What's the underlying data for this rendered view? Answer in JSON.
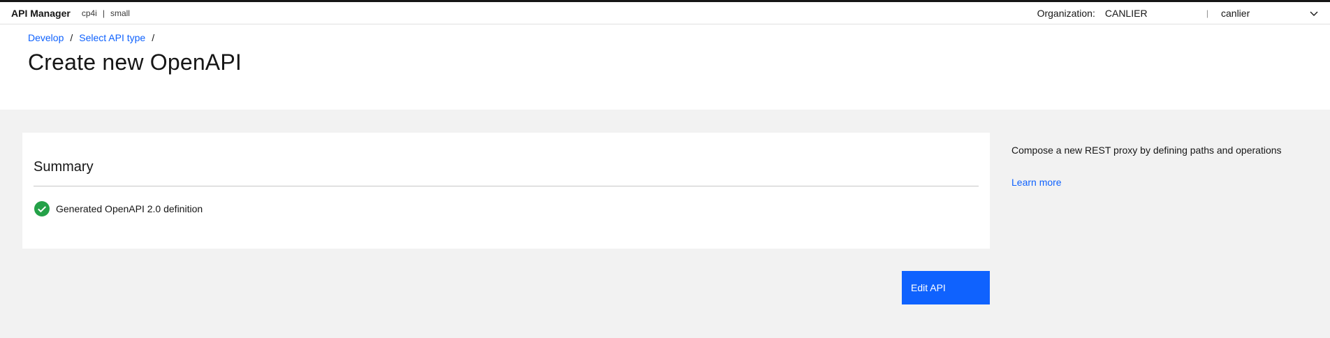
{
  "header": {
    "brand": "API Manager",
    "instance_name": "cp4i",
    "instance_sep": "|",
    "instance_size": "small",
    "org_label": "Organization:",
    "org_name": "CANLIER",
    "separator": "|",
    "user_name": "canlier",
    "user_menu_icon": "chevron-down-icon"
  },
  "breadcrumb": {
    "items": [
      "Develop",
      "Select API type"
    ],
    "separator": "/"
  },
  "page": {
    "title": "Create new OpenAPI"
  },
  "summary": {
    "title": "Summary",
    "status_icon": "checkmark-filled-icon",
    "status_text": "Generated OpenAPI 2.0 definition"
  },
  "sidepanel": {
    "description": "Compose a new REST proxy by defining paths and operations",
    "link": "Learn more"
  },
  "actions": {
    "edit_label": "Edit API"
  },
  "colors": {
    "link": "#0f62fe",
    "primary": "#0f62fe",
    "success": "#24a148",
    "background": "#f2f2f2"
  }
}
